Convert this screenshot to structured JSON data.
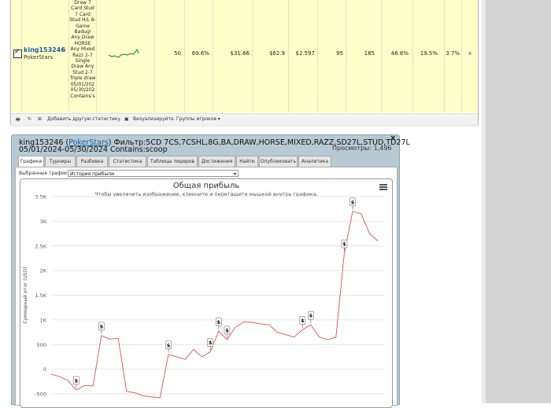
{
  "table": {
    "player_name": "king153246",
    "player_site": "PokerStars",
    "games_list": "Draw 7 Card Stud 7 Card Stud H/L 8-Game Badugi Any Draw HORSE Any Mixed Razz 2-7 Single Draw Any Stud 2-7 Triple draw 05/01/202 05/30/202 Contains:s",
    "cells": [
      "50",
      "69.6%",
      "$31.66",
      "$62.9",
      "$2.597",
      "95",
      "185",
      "46.6%",
      "19.5%",
      "3.7%"
    ],
    "remove_label": "x"
  },
  "toolbar": {
    "add_stat": "Добавить другую статистику",
    "visualize": "Визуализируйте",
    "player_groups": "Группы игроков ▾"
  },
  "stats": {
    "player": "king153246",
    "site": "PokerStars",
    "filter_line1": " Фильтр:5CD 7CS,7CSHL,8G,BA,DRAW,HORSE,MIXED,RAZZ,SD27L,STUD,TD27L",
    "filter_line2": "05/01/2024-05/30/2024 Contains:scoop",
    "views": "Просмотры: 1,496",
    "close": "×",
    "tabs": [
      "Графики",
      "Турниры",
      "Разбивка",
      "Статистика",
      "Таблицы лидеров",
      "Достижения",
      "Найти",
      "Опубликовать",
      "Аналитика"
    ],
    "select_label": "Выбранные графики:",
    "select_value": "История прибыли"
  },
  "chart_data": {
    "type": "line",
    "title": "Общая прибыль",
    "subtitle": "Чтобы увеличить изображение, кликните и перетащите мышкой внутрь графика.",
    "ylabel": "Суммарный итог (USD)",
    "ylim": [
      -500,
      3500
    ],
    "yticks": [
      "3.5K",
      "3K",
      "2.5K",
      "2K",
      "1.5K",
      "1K",
      "500",
      "0",
      "-500"
    ],
    "color": "#d9534f",
    "series": [
      {
        "values": [
          -100,
          -150,
          -230,
          -420,
          -330,
          -340,
          680,
          610,
          630,
          -450,
          -480,
          -540,
          -560,
          -580,
          300,
          250,
          200,
          400,
          250,
          350,
          770,
          600,
          850,
          960,
          950,
          920,
          900,
          750,
          700,
          650,
          800,
          900,
          650,
          600,
          650,
          2350,
          3200,
          3150,
          2750,
          2600
        ]
      }
    ],
    "markers": [
      {
        "index": 3,
        "label": "$"
      },
      {
        "index": 6,
        "label": "$"
      },
      {
        "index": 14,
        "label": "$"
      },
      {
        "index": 19,
        "label": "$"
      },
      {
        "index": 20,
        "label": "$"
      },
      {
        "index": 21,
        "label": "$"
      },
      {
        "index": 30,
        "label": "$"
      },
      {
        "index": 31,
        "label": "$"
      },
      {
        "index": 35,
        "label": "$"
      },
      {
        "index": 36,
        "label": "$"
      }
    ]
  }
}
